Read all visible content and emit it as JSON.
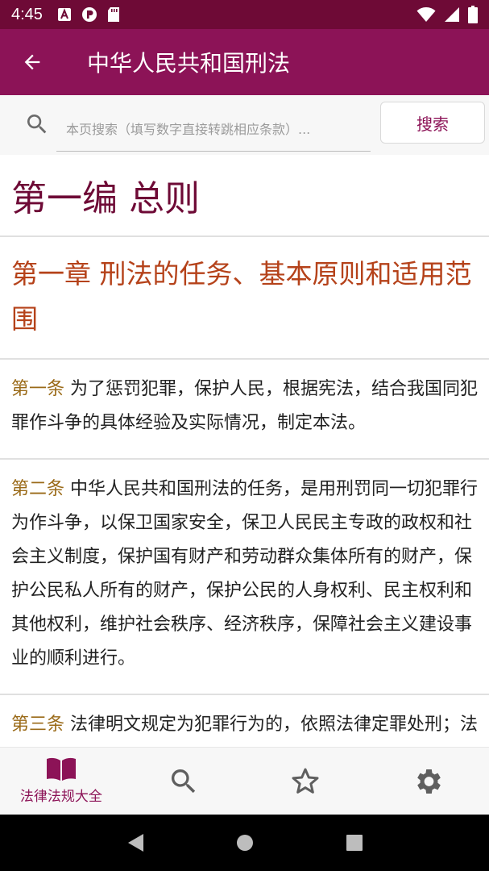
{
  "status_bar": {
    "time": "4:45",
    "icons": [
      "text-a-icon",
      "circle-p-icon",
      "sd-card-icon",
      "wifi-icon",
      "signal-icon",
      "battery-icon"
    ]
  },
  "app_bar": {
    "title": "中华人民共和国刑法",
    "back_icon": "arrow-left-icon"
  },
  "search": {
    "placeholder": "本页搜索（填写数字直接转跳相应条款）...",
    "value": "",
    "button_label": "搜索"
  },
  "content": {
    "part_title": "第一编 总则",
    "chapter_title": "第一章 刑法的任务、基本原则和适用范围",
    "articles": [
      {
        "label": "第一条",
        "text": " 为了惩罚犯罪，保护人民，根据宪法，结合我国同犯罪作斗争的具体经验及实际情况，制定本法。"
      },
      {
        "label": "第二条",
        "text": " 中华人民共和国刑法的任务，是用刑罚同一切犯罪行为作斗争，以保卫国家安全，保卫人民民主专政的政权和社会主义制度，保护国有财产和劳动群众集体所有的财产，保护公民私人所有的财产，保护公民的人身权利、民主权利和其他权利，维护社会秩序、经济秩序，保障社会主义建设事业的顺利进行。"
      },
      {
        "label": "第三条",
        "text": " 法律明文规定为犯罪行为的，依照法律定罪处刑；法律没有明文规定为犯罪行为的，不得定罪处刑。"
      }
    ]
  },
  "bottom_nav": {
    "items": [
      {
        "label": "法律法规大全",
        "icon": "book-icon",
        "active": true
      },
      {
        "label": "",
        "icon": "search-icon",
        "active": false
      },
      {
        "label": "",
        "icon": "star-icon",
        "active": false
      },
      {
        "label": "",
        "icon": "gear-icon",
        "active": false
      }
    ]
  },
  "colors": {
    "primary": "#8c1357",
    "status_bar": "#6e0a36",
    "part_title": "#6e0a36",
    "chapter_title": "#b5421a",
    "article_label": "#9a6a18",
    "inactive_icon": "#5f5f5f"
  }
}
